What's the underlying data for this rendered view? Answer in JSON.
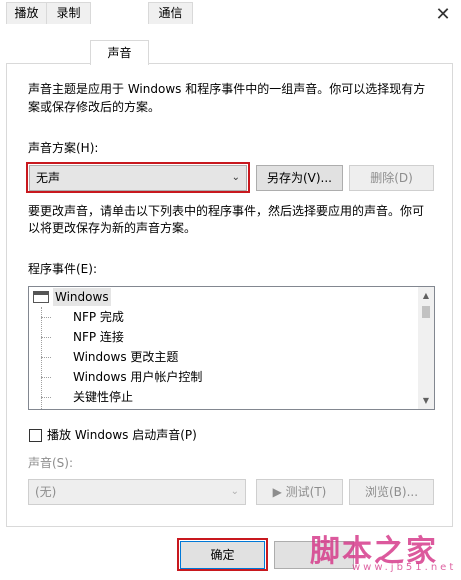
{
  "window": {
    "title": "声音",
    "close_glyph": "✕",
    "icon": "speaker-icon"
  },
  "tabs": [
    {
      "label": "播放"
    },
    {
      "label": "录制"
    },
    {
      "label": "声音",
      "active": true
    },
    {
      "label": "通信"
    }
  ],
  "panel": {
    "intro_line1": "声音主题是应用于 Windows 和程序事件中的一组声音。你可以选择现有方",
    "intro_line2": "案或保存修改后的方案。",
    "scheme_label": "声音方案(H):",
    "scheme_value": "无声",
    "save_as_label": "另存为(V)...",
    "delete_label": "删除(D)",
    "change_line1": "要更改声音，请单击以下列表中的程序事件，然后选择要应用的声音。你可",
    "change_line2": "以将更改保存为新的声音方案。",
    "events_label": "程序事件(E):",
    "events": {
      "root": "Windows",
      "items": [
        "NFP 完成",
        "NFP 连接",
        "Windows 更改主题",
        "Windows 用户帐户控制",
        "关键性停止"
      ]
    },
    "startup_sound_label": "播放 Windows 启动声音(P)",
    "startup_sound_checked": false,
    "sound_label": "声音(S):",
    "sound_value": "(无)",
    "test_label": "▶ 测试(T)",
    "browse_label": "浏览(B)..."
  },
  "buttons": {
    "ok_label": "确定"
  },
  "watermark": {
    "main": "脚本之家",
    "url": "www.jb51.net"
  },
  "colors": {
    "highlight_red": "#c8181e",
    "watermark_pink": "#d63d8c"
  }
}
